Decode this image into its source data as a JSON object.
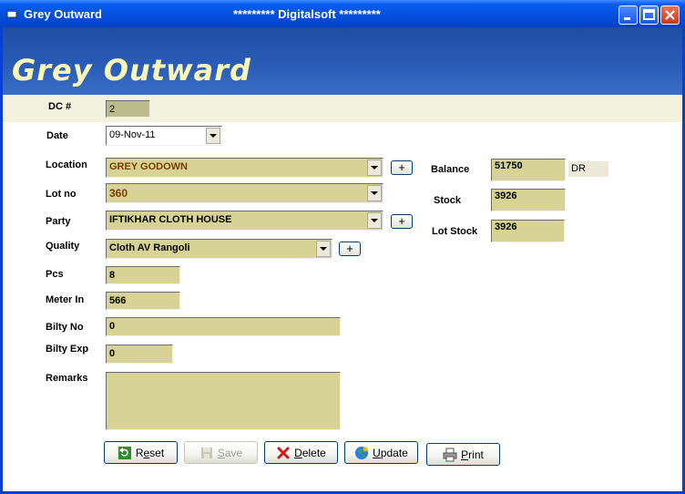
{
  "window": {
    "title": "Grey Outward",
    "center_title": "********* Digitalsoft *********"
  },
  "banner": {
    "title": "Grey Outward"
  },
  "dc": {
    "label": "DC #",
    "value": "2"
  },
  "date": {
    "label": "Date",
    "value": "09-Nov-11"
  },
  "location": {
    "label": "Location",
    "value": "GREY GODOWN"
  },
  "lot_no": {
    "label": "Lot no",
    "value": "360"
  },
  "party": {
    "label": "Party",
    "value": "IFTIKHAR CLOTH HOUSE"
  },
  "quality": {
    "label": "Quality",
    "value": "Cloth AV Rangoli"
  },
  "pcs": {
    "label": "Pcs",
    "value": "8"
  },
  "meter_in": {
    "label": "Meter In",
    "value": "566"
  },
  "bilty_no": {
    "label": "Bilty No",
    "value": "0"
  },
  "bilty_exp": {
    "label": "Bilty Exp",
    "value": "0"
  },
  "remarks": {
    "label": "Remarks",
    "value": ""
  },
  "balance": {
    "label": "Balance",
    "value": "51750",
    "suffix": "DR"
  },
  "stock": {
    "label": "Stock",
    "value": "3926"
  },
  "lot_stock": {
    "label": "Lot Stock",
    "value": "3926"
  },
  "add_symbol": "+",
  "buttons": {
    "reset": {
      "pre": "R",
      "ul": "e",
      "post": "set"
    },
    "save": {
      "pre": "",
      "ul": "S",
      "post": "ave"
    },
    "delete": {
      "pre": "",
      "ul": "D",
      "post": "elete"
    },
    "update": {
      "pre": "",
      "ul": "U",
      "post": "pdate"
    },
    "print": {
      "pre": "",
      "ul": "P",
      "post": "rint"
    }
  },
  "colors": {
    "field_bg": "#d7d395",
    "banner_bg": "#2a5db8",
    "banner_text": "#fbf6b8",
    "titlebar": "#0551e0"
  }
}
